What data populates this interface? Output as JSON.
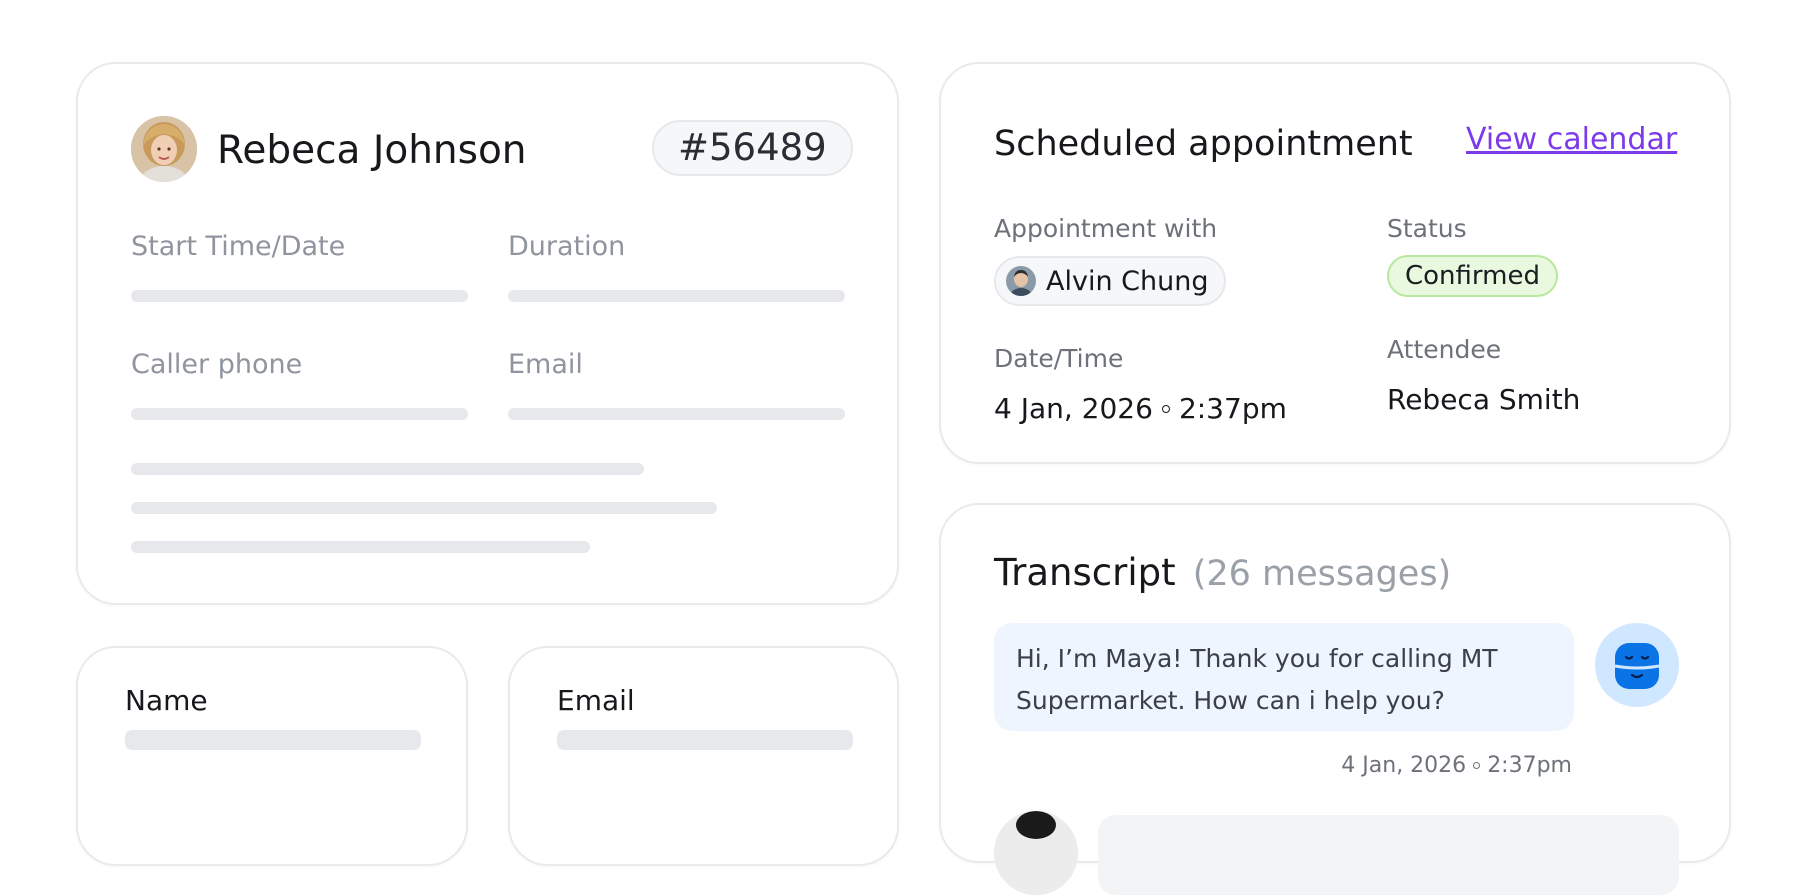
{
  "contact_card": {
    "name": "Rebeca Johnson",
    "id_badge": "#56489",
    "fields": {
      "start_time_label": "Start Time/Date",
      "duration_label": "Duration",
      "caller_phone_label": "Caller phone",
      "email_label": "Email"
    }
  },
  "small_cards": {
    "name_label": "Name",
    "email_label": "Email"
  },
  "appointment": {
    "title": "Scheduled appointment",
    "view_calendar_link": "View calendar",
    "with_label": "Appointment with",
    "with_person": "Alvin Chung",
    "status_label": "Status",
    "status_value": "Confirmed",
    "datetime_label": "Date/Time",
    "datetime_date": "4 Jan, 2026",
    "datetime_time": "2:37pm",
    "attendee_label": "Attendee",
    "attendee_value": "Rebeca Smith"
  },
  "transcript": {
    "title": "Transcript",
    "count": "(26 messages)",
    "messages": [
      {
        "text": "Hi, I’m Maya! Thank you for calling MT Supermarket. How can i help you?",
        "date": "4 Jan, 2026",
        "time": "2:37pm",
        "avatar_icon": "bot-face-icon"
      }
    ]
  },
  "colors": {
    "link": "#7c3aed",
    "status_bg": "#e9f9df",
    "status_border": "#b8e8a0",
    "bubble_bg": "#eef5ff",
    "bot_avatar_bg": "#cfe7ff",
    "bot_avatar_fg": "#0a74e6"
  }
}
